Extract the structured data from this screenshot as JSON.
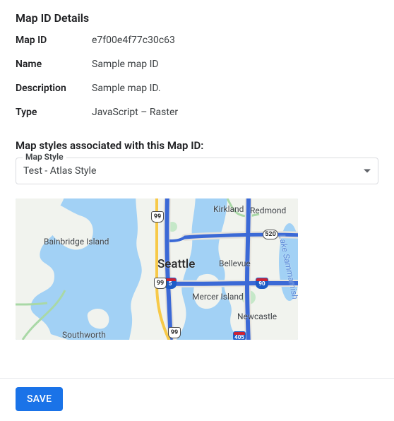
{
  "header": {
    "title": "Map ID Details"
  },
  "details": {
    "labels": {
      "id": "Map ID",
      "name": "Name",
      "description": "Description",
      "type": "Type"
    },
    "values": {
      "id": "e7f00e4f77c30c63",
      "name": "Sample map ID",
      "description": "Sample map ID.",
      "type": "JavaScript – Raster"
    }
  },
  "styles": {
    "heading": "Map styles associated with this Map ID:",
    "field_label": "Map Style",
    "selected": "Test - Atlas Style"
  },
  "map": {
    "places": {
      "seattle": "Seattle",
      "bellevue": "Bellevue",
      "kirkland": "Kirkland",
      "redmond": "Redmond",
      "bainbridge": "Bainbridge Island",
      "mercer": "Mercer Island",
      "newcastle": "Newcastle",
      "southworth": "Southworth",
      "sammamish": "Lake Sammamish"
    },
    "shields": {
      "i5": "5",
      "i405": "405",
      "i90": "90",
      "us99a": "99",
      "us99b": "99",
      "us99c": "99",
      "sr520": "520"
    }
  },
  "footer": {
    "save": "SAVE"
  }
}
